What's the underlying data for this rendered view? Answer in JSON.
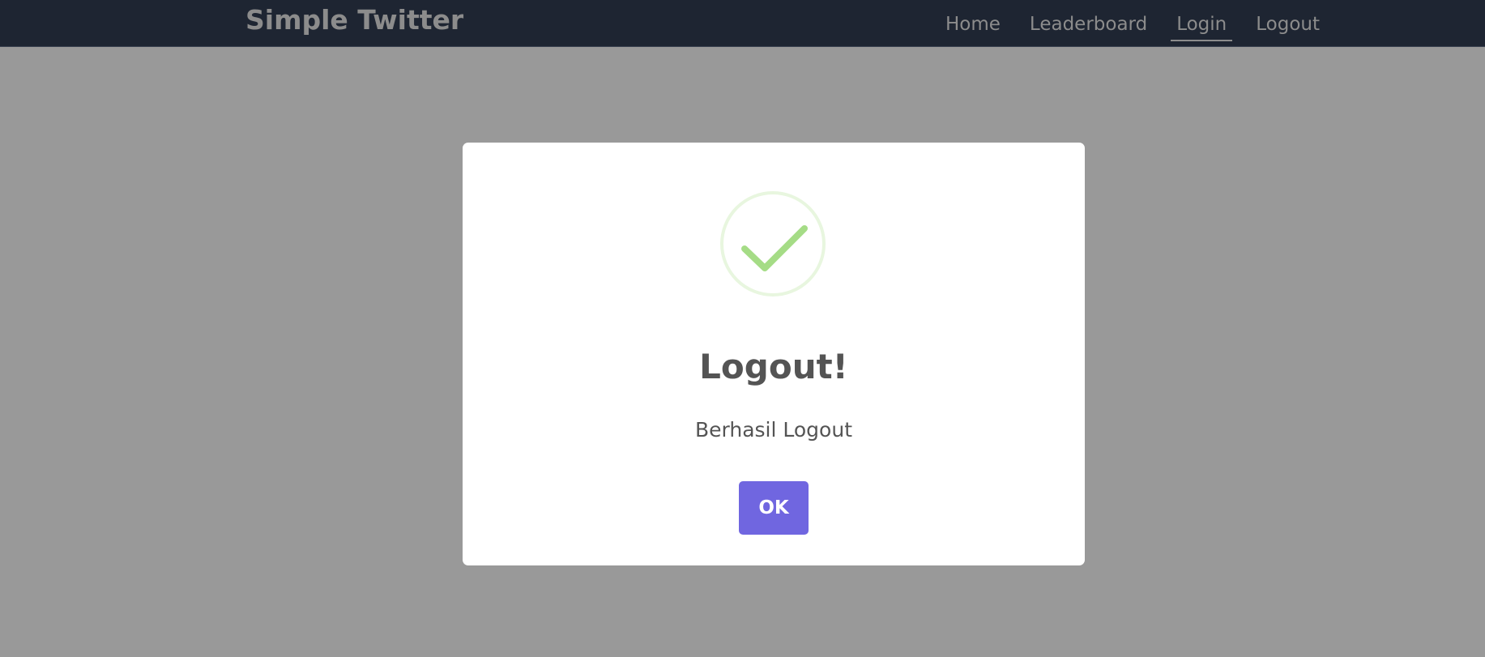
{
  "navbar": {
    "brand": "Simple Twitter",
    "links": [
      {
        "label": "Home",
        "active": false
      },
      {
        "label": "Leaderboard",
        "active": false
      },
      {
        "label": "Login",
        "active": true
      },
      {
        "label": "Logout",
        "active": false
      }
    ]
  },
  "dialog": {
    "icon": "success-check-icon",
    "title": "Logout!",
    "message": "Berhasil Logout",
    "confirm_label": "OK"
  },
  "colors": {
    "navbar_bg": "#1e2532",
    "backdrop": "#999999",
    "success_green": "#a5dc86",
    "confirm_button": "#7066e0",
    "text": "#545454"
  }
}
